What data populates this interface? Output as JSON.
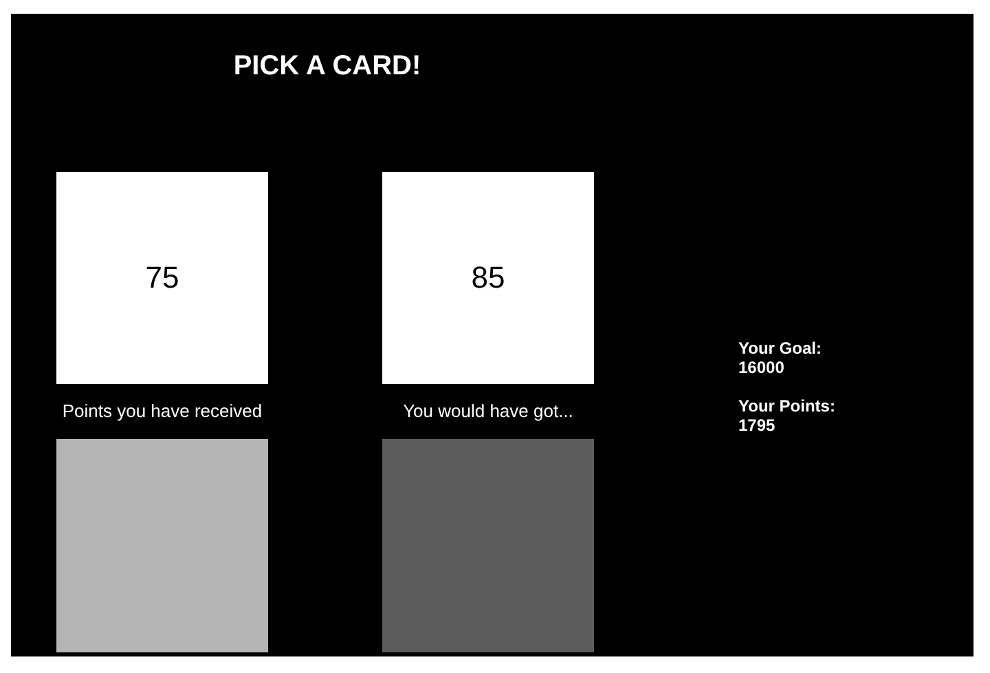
{
  "title": "PICK A CARD!",
  "columns": [
    {
      "card": "75",
      "label": "Points you have received",
      "color": "#b4b4b4"
    },
    {
      "card": "85",
      "label": "You would have got...",
      "color": "#5c5c5c"
    }
  ],
  "stats": [
    {
      "label": "Your Goal:",
      "value": "16000"
    },
    {
      "label": "Your Points:",
      "value": "1795"
    }
  ]
}
